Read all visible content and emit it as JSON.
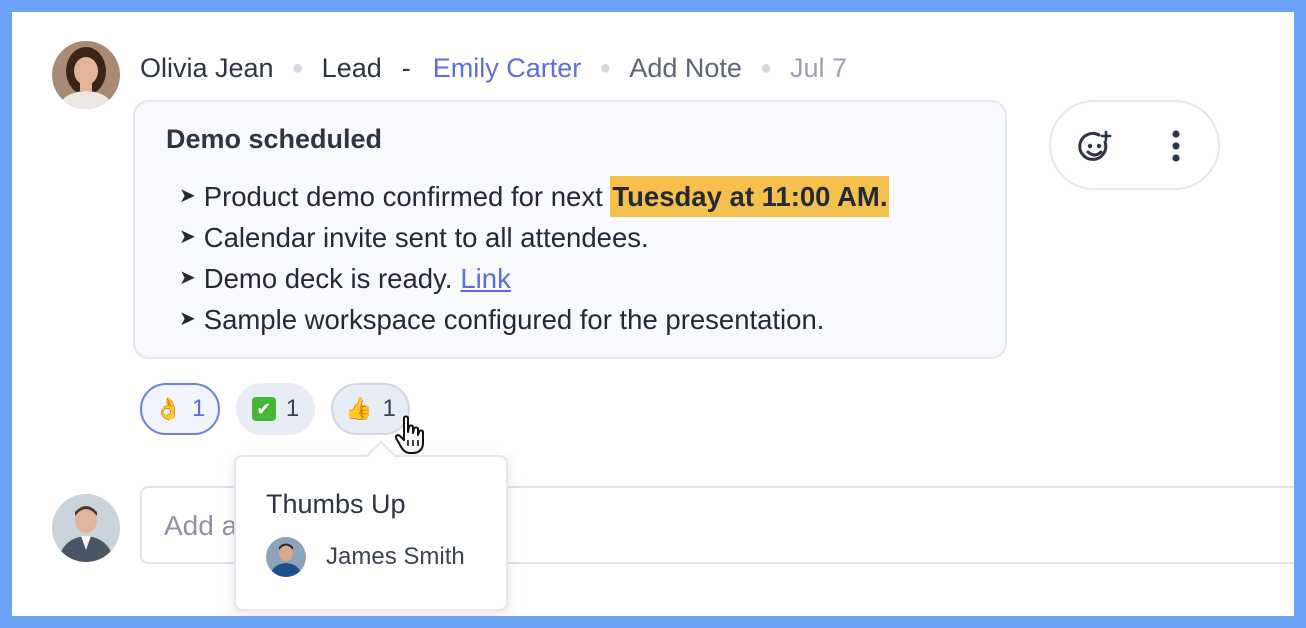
{
  "activity": {
    "author": "Olivia Jean",
    "role": "Lead",
    "separator": "-",
    "mention": "Emily Carter",
    "action": "Add Note",
    "date": "Jul 7"
  },
  "note": {
    "title": "Demo scheduled",
    "bullet1_text": "Product demo confirmed for next",
    "bullet1_highlight": "Tuesday at 11:00 AM.",
    "bullet2_text": "Calendar invite sent to all attendees.",
    "bullet3_text": "Demo deck is ready.",
    "bullet3_link": "Link",
    "bullet4_text": "Sample workspace configured for the presentation."
  },
  "reactions": [
    {
      "emoji": "👌",
      "count": "1"
    },
    {
      "emoji": "✔",
      "count": "1"
    },
    {
      "emoji": "👍",
      "count": "1"
    }
  ],
  "tooltip": {
    "title": "Thumbs Up",
    "user": "James Smith"
  },
  "comment": {
    "placeholder": "Add a comment..."
  },
  "colors": {
    "frame": "#6aa2f7",
    "accent": "#5c6ee3",
    "highlight": "#f5c04c",
    "check_green": "#47b536"
  },
  "icons": {
    "actions": [
      "add-reaction-icon",
      "more-vertical-icon"
    ],
    "cursor": "hand-pointer-icon"
  }
}
